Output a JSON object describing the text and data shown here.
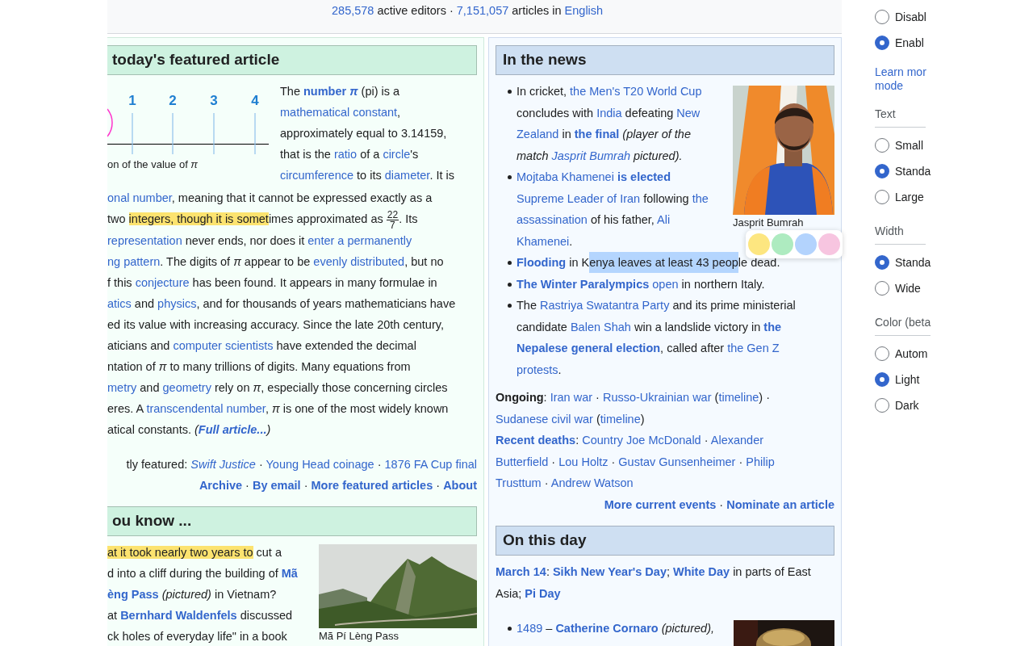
{
  "stats_line": [
    {
      "kind": "link",
      "text": "285,578"
    },
    {
      "kind": "text",
      "text": " active editors · "
    },
    {
      "kind": "link",
      "text": "7,151,057"
    },
    {
      "kind": "text",
      "text": " articles in "
    },
    {
      "kind": "link",
      "text": "English"
    }
  ],
  "featured": {
    "heading": "today's featured article",
    "figure": {
      "tick_labels": [
        "1",
        "2",
        "3",
        "4"
      ],
      "caption": "on of the value of *π*"
    },
    "lines": [
      [
        {
          "kind": "text",
          "text": "The "
        },
        {
          "kind": "bold-link",
          "text": "number *π*"
        },
        {
          "kind": "text",
          "text": " (pi) is a"
        }
      ],
      [
        {
          "kind": "link",
          "text": "mathematical constant"
        },
        {
          "kind": "text",
          "text": ","
        }
      ],
      [
        {
          "kind": "text",
          "text": "approximately equal to 3.14159,"
        }
      ],
      [
        {
          "kind": "text",
          "text": "that is the "
        },
        {
          "kind": "link",
          "text": "ratio"
        },
        {
          "kind": "text",
          "text": " of a "
        },
        {
          "kind": "link",
          "text": "circle"
        },
        {
          "kind": "text",
          "text": "'s"
        }
      ],
      [
        {
          "kind": "link",
          "text": "circumference"
        },
        {
          "kind": "text",
          "text": " to its "
        },
        {
          "kind": "link",
          "text": "diameter"
        },
        {
          "kind": "text",
          "text": ". It is"
        }
      ],
      [
        {
          "kind": "link",
          "text": "onal number"
        },
        {
          "kind": "text",
          "text": ", meaning that it cannot be expressed exactly as a"
        }
      ],
      [
        {
          "kind": "text",
          "text": "two "
        },
        {
          "kind": "highlight",
          "text": "integers, though it is somet"
        },
        {
          "kind": "text",
          "text": "imes approximated as "
        },
        {
          "kind": "fraction",
          "numerator": "22",
          "denominator": "7"
        },
        {
          "kind": "text",
          "text": ". Its"
        }
      ],
      [
        {
          "kind": "link",
          "text": "representation"
        },
        {
          "kind": "text",
          "text": " never ends, nor does it "
        },
        {
          "kind": "link",
          "text": "enter a permanently"
        }
      ],
      [
        {
          "kind": "link",
          "text": "ng pattern"
        },
        {
          "kind": "text",
          "text": ". The digits of "
        },
        {
          "kind": "italic",
          "text": "π"
        },
        {
          "kind": "text",
          "text": " appear to be "
        },
        {
          "kind": "link",
          "text": "evenly distributed"
        },
        {
          "kind": "text",
          "text": ", but no"
        }
      ],
      [
        {
          "kind": "text",
          "text": "f this "
        },
        {
          "kind": "link",
          "text": "conjecture"
        },
        {
          "kind": "text",
          "text": " has been found. It appears in many formulae in"
        }
      ],
      [
        {
          "kind": "link",
          "text": "atics"
        },
        {
          "kind": "text",
          "text": " and "
        },
        {
          "kind": "link",
          "text": "physics"
        },
        {
          "kind": "text",
          "text": ", and for thousands of years mathematicians have"
        }
      ],
      [
        {
          "kind": "text",
          "text": "ed its value with increasing accuracy. Since the late 20th century,"
        }
      ],
      [
        {
          "kind": "text",
          "text": "aticians and "
        },
        {
          "kind": "link",
          "text": "computer scientists"
        },
        {
          "kind": "text",
          "text": " have extended the decimal"
        }
      ],
      [
        {
          "kind": "text",
          "text": "ntation of "
        },
        {
          "kind": "italic",
          "text": "π"
        },
        {
          "kind": "text",
          "text": " to many trillions of digits. Many equations from"
        }
      ],
      [
        {
          "kind": "link",
          "text": "metry"
        },
        {
          "kind": "text",
          "text": " and "
        },
        {
          "kind": "link",
          "text": "geometry"
        },
        {
          "kind": "text",
          "text": " rely on "
        },
        {
          "kind": "italic",
          "text": "π"
        },
        {
          "kind": "text",
          "text": ", especially those concerning circles"
        }
      ],
      [
        {
          "kind": "text",
          "text": "eres. A "
        },
        {
          "kind": "link",
          "text": "transcendental number"
        },
        {
          "kind": "text",
          "text": ", "
        },
        {
          "kind": "italic",
          "text": "π"
        },
        {
          "kind": "text",
          "text": " is one of the most widely known"
        }
      ],
      [
        {
          "kind": "text",
          "text": "atical constants. "
        },
        {
          "kind": "italic",
          "text": "("
        },
        {
          "kind": "bold-italic-link",
          "text": "Full article..."
        },
        {
          "kind": "italic",
          "text": ")"
        }
      ]
    ],
    "recently_featured": [
      {
        "kind": "text",
        "text": "tly featured: "
      },
      {
        "kind": "italic-link",
        "text": "Swift Justice"
      },
      {
        "kind": "text",
        "text": " · "
      },
      {
        "kind": "link",
        "text": "Young Head coinage"
      },
      {
        "kind": "text",
        "text": " · "
      },
      {
        "kind": "link",
        "text": "1876 FA Cup final"
      }
    ],
    "footer": [
      {
        "kind": "bold-link",
        "text": "Archive"
      },
      {
        "kind": "text",
        "text": " · "
      },
      {
        "kind": "bold-link",
        "text": "By email"
      },
      {
        "kind": "text",
        "text": " · "
      },
      {
        "kind": "bold-link",
        "text": "More featured articles"
      },
      {
        "kind": "text",
        "text": " · "
      },
      {
        "kind": "bold-link",
        "text": "About"
      }
    ]
  },
  "did_you_know": {
    "heading": "ou know ...",
    "picture": {
      "kind": "picture",
      "caption": "Mã Pí Lèng Pass"
    },
    "lines": [
      [
        {
          "kind": "highlight",
          "text": "at it took nearly two years to"
        },
        {
          "kind": "text",
          "text": " cut a"
        }
      ],
      [
        {
          "kind": "text",
          "text": "d into a cliff during the building of "
        },
        {
          "kind": "bold-link",
          "text": "Mã"
        }
      ],
      [
        {
          "kind": "bold-link",
          "text": "èng Pass"
        },
        {
          "kind": "italic",
          "text": " (pictured)"
        },
        {
          "kind": "text",
          "text": " in Vietnam?"
        }
      ],
      [
        {
          "kind": "text",
          "text": "at "
        },
        {
          "kind": "bold-link",
          "text": "Bernhard Waldenfels"
        },
        {
          "kind": "text",
          "text": " discussed"
        }
      ],
      [
        {
          "kind": "text",
          "text": "ck holes of everyday life\" in a book"
        }
      ]
    ]
  },
  "in_the_news": {
    "heading": "In the news",
    "picture": {
      "kind": "picture",
      "caption": "Jasprit Bumrah"
    },
    "items": [
      {
        "lines": [
          [
            {
              "kind": "text",
              "text": "In cricket, "
            },
            {
              "kind": "link",
              "text": "the Men's T20 World Cup"
            }
          ],
          [
            {
              "kind": "text",
              "text": "concludes with "
            },
            {
              "kind": "link",
              "text": "India"
            },
            {
              "kind": "text",
              "text": " defeating "
            },
            {
              "kind": "link",
              "text": "New"
            }
          ],
          [
            {
              "kind": "link",
              "text": "Zealand"
            },
            {
              "kind": "text",
              "text": " in "
            },
            {
              "kind": "bold-link",
              "text": "the final"
            },
            {
              "kind": "italic",
              "text": " (player of the"
            }
          ],
          [
            {
              "kind": "italic",
              "text": "match "
            },
            {
              "kind": "italic-link",
              "text": "Jasprit Bumrah"
            },
            {
              "kind": "italic",
              "text": " pictured)."
            }
          ]
        ]
      },
      {
        "lines": [
          [
            {
              "kind": "link",
              "text": "Mojtaba Khamenei"
            },
            {
              "kind": "bold-link",
              "text": " is elected"
            }
          ],
          [
            {
              "kind": "link",
              "text": "Supreme Leader of Iran"
            },
            {
              "kind": "text",
              "text": " following "
            },
            {
              "kind": "link",
              "text": "the"
            }
          ],
          [
            {
              "kind": "link",
              "text": "assassination"
            },
            {
              "kind": "text",
              "text": " of his father, "
            },
            {
              "kind": "link",
              "text": "Ali"
            }
          ],
          [
            {
              "kind": "link",
              "text": "Khamenei"
            },
            {
              "kind": "text",
              "text": "."
            }
          ]
        ]
      },
      {
        "lines": [
          [
            {
              "kind": "bold-link",
              "text": "Flooding"
            },
            {
              "kind": "text",
              "text": " in K"
            },
            {
              "kind": "selection",
              "text": "enya leaves at least 43 peop"
            },
            {
              "kind": "text",
              "text": "le dead."
            }
          ]
        ]
      },
      {
        "lines": [
          [
            {
              "kind": "bold-link",
              "text": "The Winter Paralympics"
            },
            {
              "kind": "link",
              "text": " open"
            },
            {
              "kind": "text",
              "text": " in northern Italy."
            }
          ]
        ]
      },
      {
        "lines": [
          [
            {
              "kind": "text",
              "text": "The "
            },
            {
              "kind": "link",
              "text": "Rastriya Swatantra Party"
            },
            {
              "kind": "text",
              "text": " and its prime ministerial"
            }
          ],
          [
            {
              "kind": "text",
              "text": "candidate "
            },
            {
              "kind": "link",
              "text": "Balen Shah"
            },
            {
              "kind": "text",
              "text": " win a landslide victory in "
            },
            {
              "kind": "bold-link",
              "text": "the"
            }
          ],
          [
            {
              "kind": "bold-link",
              "text": "Nepalese general election"
            },
            {
              "kind": "text",
              "text": ", called after "
            },
            {
              "kind": "link",
              "text": "the Gen Z"
            }
          ],
          [
            {
              "kind": "link",
              "text": "protests"
            },
            {
              "kind": "text",
              "text": "."
            }
          ]
        ]
      }
    ],
    "ongoing": [
      [
        {
          "kind": "bold",
          "text": "Ongoing"
        },
        {
          "kind": "text",
          "text": ": "
        },
        {
          "kind": "link",
          "text": "Iran war"
        },
        {
          "kind": "text",
          "text": " · "
        },
        {
          "kind": "link",
          "text": "Russo-Ukrainian war"
        },
        {
          "kind": "text",
          "text": " ("
        },
        {
          "kind": "link",
          "text": "timeline"
        },
        {
          "kind": "text",
          "text": ") ·"
        }
      ],
      [
        {
          "kind": "link",
          "text": "Sudanese civil war"
        },
        {
          "kind": "text",
          "text": " ("
        },
        {
          "kind": "link",
          "text": "timeline"
        },
        {
          "kind": "text",
          "text": ")"
        }
      ]
    ],
    "recent_deaths": [
      [
        {
          "kind": "bold-link",
          "text": "Recent deaths"
        },
        {
          "kind": "text",
          "text": ": "
        },
        {
          "kind": "link",
          "text": "Country Joe McDonald"
        },
        {
          "kind": "text",
          "text": " · "
        },
        {
          "kind": "link",
          "text": "Alexander"
        }
      ],
      [
        {
          "kind": "link",
          "text": "Butterfield"
        },
        {
          "kind": "text",
          "text": " · "
        },
        {
          "kind": "link",
          "text": "Lou Holtz"
        },
        {
          "kind": "text",
          "text": " · "
        },
        {
          "kind": "link",
          "text": "Gustav Gunsenheimer"
        },
        {
          "kind": "text",
          "text": " · "
        },
        {
          "kind": "link",
          "text": "Philip"
        }
      ],
      [
        {
          "kind": "link",
          "text": "Trusttum"
        },
        {
          "kind": "text",
          "text": " · "
        },
        {
          "kind": "link",
          "text": "Andrew Watson"
        }
      ]
    ],
    "footer": [
      {
        "kind": "bold-link",
        "text": "More current events"
      },
      {
        "kind": "text",
        "text": " · "
      },
      {
        "kind": "bold-link",
        "text": "Nominate an article"
      }
    ]
  },
  "highlight_colors": [
    {
      "color": "#fde680"
    },
    {
      "color": "#aeebc0"
    },
    {
      "color": "#b3d3fd"
    },
    {
      "color": "#f7c5e0"
    }
  ],
  "on_this_day": {
    "heading": "On this day",
    "lines": [
      [
        {
          "kind": "bold-link",
          "text": "March 14"
        },
        {
          "kind": "text",
          "text": ": "
        },
        {
          "kind": "bold-link",
          "text": "Sikh New Year's Day"
        },
        {
          "kind": "text",
          "text": "; "
        },
        {
          "kind": "bold-link",
          "text": "White Day"
        },
        {
          "kind": "text",
          "text": " in parts of East"
        }
      ],
      [
        {
          "kind": "text",
          "text": "Asia; "
        },
        {
          "kind": "bold-link",
          "text": "Pi Day"
        }
      ]
    ],
    "picture": {
      "kind": "picture"
    },
    "items": [
      {
        "lines": [
          [
            {
              "kind": "link",
              "text": "1489"
            },
            {
              "kind": "text",
              "text": " – "
            },
            {
              "kind": "bold-link",
              "text": "Catherine Cornaro"
            },
            {
              "kind": "italic",
              "text": " (pictured),"
            }
          ]
        ]
      }
    ]
  },
  "settings": {
    "options": [
      {
        "label": "Disabl",
        "selected": false
      },
      {
        "label": "Enabl",
        "selected": true
      }
    ],
    "learn_more": [
      "Learn mor",
      "mode"
    ],
    "groups": [
      {
        "heading": "Text",
        "options": [
          {
            "label": "Small",
            "selected": false
          },
          {
            "label": "Standa",
            "selected": true
          },
          {
            "label": "Large",
            "selected": false
          }
        ]
      },
      {
        "heading": "Width",
        "options": [
          {
            "label": "Standa",
            "selected": true
          },
          {
            "label": "Wide",
            "selected": false
          }
        ]
      },
      {
        "heading": "Color (beta",
        "options": [
          {
            "label": "Autom",
            "selected": false
          },
          {
            "label": "Light",
            "selected": true
          },
          {
            "label": "Dark",
            "selected": false
          }
        ]
      }
    ]
  }
}
